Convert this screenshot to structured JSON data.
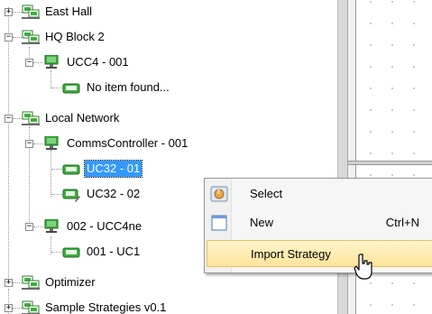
{
  "tree": {
    "items": [
      {
        "label": "East Hall",
        "expander": "+",
        "icon": "building-network-icon"
      },
      {
        "label": "HQ Block 2",
        "expander": "−",
        "icon": "building-network-icon"
      },
      {
        "label": "UCC4 - 001",
        "expander": "−",
        "icon": "controller-monitor-icon"
      },
      {
        "label": "No item found...",
        "expander": "",
        "icon": "device-icon"
      },
      {
        "label": "Local Network",
        "expander": "−",
        "icon": "building-network-icon"
      },
      {
        "label": "CommsController - 001",
        "expander": "−",
        "icon": "controller-monitor-icon"
      },
      {
        "label": "UC32 - 01",
        "expander": "",
        "icon": "device-icon",
        "selected": true
      },
      {
        "label": "UC32 - 02",
        "expander": "",
        "icon": "device-edit-icon"
      },
      {
        "label": "002 - UCC4ne",
        "expander": "−",
        "icon": "controller-monitor-icon"
      },
      {
        "label": "001 - UC1",
        "expander": "",
        "icon": "device-icon"
      },
      {
        "label": "Optimizer",
        "expander": "+",
        "icon": "building-network-icon"
      },
      {
        "label": "Sample Strategies v0.1",
        "expander": "+",
        "icon": "building-network-icon"
      }
    ]
  },
  "context_menu": {
    "items": [
      {
        "label": "Select",
        "shortcut": "",
        "icon": "select-hand-icon"
      },
      {
        "label": "New",
        "shortcut": "Ctrl+N",
        "icon": "new-document-icon"
      },
      {
        "label": "Import Strategy",
        "shortcut": "",
        "icon": "",
        "highlighted": true
      }
    ]
  },
  "colors": {
    "selection": "#3399ff",
    "menu_highlight": "#ffe39a",
    "icon_green": "#2e9a2e"
  }
}
